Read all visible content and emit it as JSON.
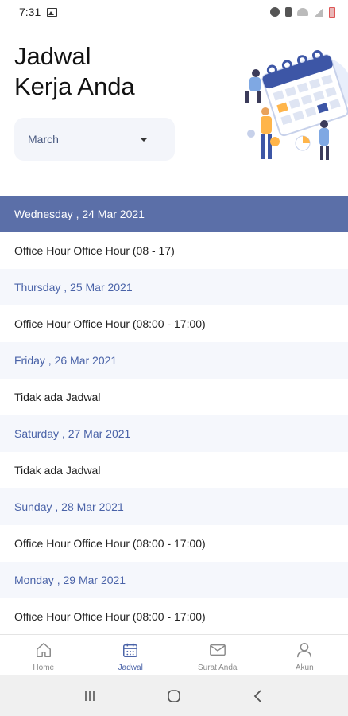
{
  "status_bar": {
    "time": "7:31"
  },
  "header": {
    "title": "Jadwal\nKerja Anda"
  },
  "month_select": {
    "value": "March"
  },
  "schedule": [
    {
      "day": "Wednesday , 24 Mar 2021",
      "shift": "Office Hour Office Hour (08 - 17)",
      "active": true
    },
    {
      "day": "Thursday , 25 Mar 2021",
      "shift": "Office Hour Office Hour (08:00 - 17:00)"
    },
    {
      "day": "Friday , 26 Mar 2021",
      "shift": "Tidak ada Jadwal"
    },
    {
      "day": "Saturday , 27 Mar 2021",
      "shift": "Tidak ada Jadwal"
    },
    {
      "day": "Sunday , 28 Mar 2021",
      "shift": "Office Hour Office Hour (08:00 - 17:00)"
    },
    {
      "day": "Monday , 29 Mar 2021",
      "shift": "Office Hour Office Hour (08:00 - 17:00)"
    }
  ],
  "bottom_nav": [
    {
      "label": "Home",
      "icon": "home-icon"
    },
    {
      "label": "Jadwal",
      "icon": "calendar-icon",
      "active": true
    },
    {
      "label": "Surat Anda",
      "icon": "mail-icon"
    },
    {
      "label": "Akun",
      "icon": "user-icon"
    }
  ],
  "colors": {
    "accent": "#5b6fa8",
    "accent_text": "#4a63a8",
    "header_bg": "#f5f7fc"
  }
}
